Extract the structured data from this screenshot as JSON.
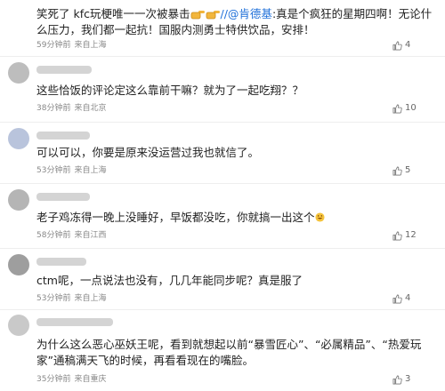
{
  "comments": [
    {
      "text": "笑死了 kfc玩梗唯一一次被暴击",
      "mention": "//@肯德基",
      "text_after": ":真是个疯狂的星期四啊！无论什么压力，我们都一起抗！国服内测勇士特供饮品，安排！",
      "time": "59分钟前",
      "location": "来自上海",
      "likes": "4"
    },
    {
      "text": "这些恰饭的评论定这么靠前干嘛？就为了一起吃翔？？",
      "time": "38分钟前",
      "location": "来自北京",
      "likes": "10"
    },
    {
      "text": "可以可以，你要是原来没运营过我也就信了。",
      "time": "53分钟前",
      "location": "来自上海",
      "likes": "5"
    },
    {
      "text": "老子鸡冻得一晚上没睡好，早饭都没吃，你就搞一出这个",
      "time": "58分钟前",
      "location": "来自江西",
      "likes": "12"
    },
    {
      "text": "ctm呢，一点说法也没有，几几年能同步呢？真是服了",
      "time": "53分钟前",
      "location": "来自上海",
      "likes": "4"
    },
    {
      "text": "为什么这么恶心巫妖王呢，看到就想起以前“暴雪匠心”、“必属精品”、“热爱玩家”通稿满天飞的时候，再看看现在的嘴脸。",
      "time": "35分钟前",
      "location": "来自重庆",
      "likes": "3"
    }
  ],
  "icons": {
    "like": "thumbs-up-icon",
    "hand": "pointing-hand-emoji",
    "face": "grinning-face-emoji"
  },
  "colors": {
    "mention": "#1e6fd9",
    "meta": "#888888"
  }
}
